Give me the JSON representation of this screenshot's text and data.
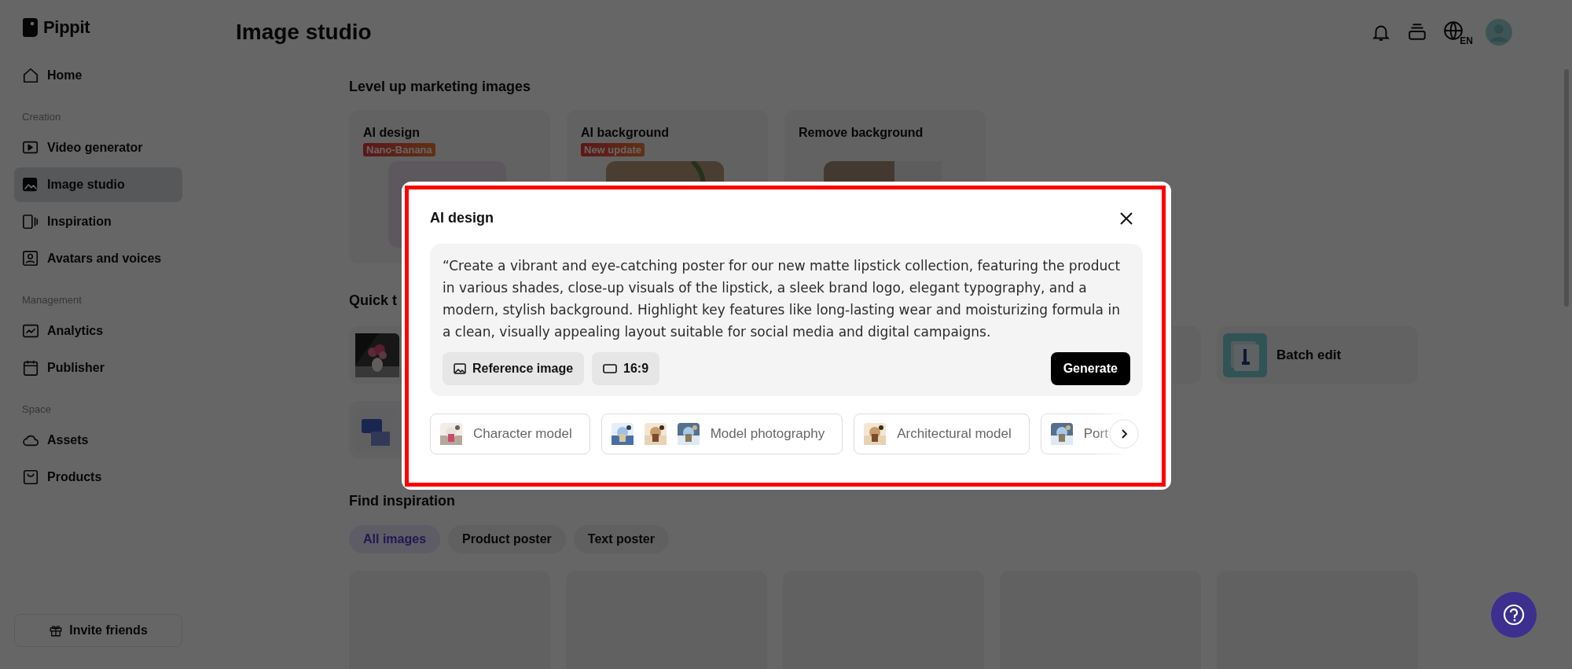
{
  "sidebar": {
    "logo": "Pippit",
    "items": [
      {
        "kind": "item",
        "label": "Home",
        "selected": false
      },
      {
        "kind": "section",
        "label": "Creation"
      },
      {
        "kind": "item",
        "label": "Video generator",
        "selected": false
      },
      {
        "kind": "item",
        "label": "Image studio",
        "selected": true
      },
      {
        "kind": "item",
        "label": "Inspiration",
        "selected": false
      },
      {
        "kind": "item",
        "label": "Avatars and voices",
        "selected": false
      },
      {
        "kind": "section",
        "label": "Management"
      },
      {
        "kind": "item",
        "label": "Analytics",
        "selected": false
      },
      {
        "kind": "item",
        "label": "Publisher",
        "selected": false
      },
      {
        "kind": "section",
        "label": "Space"
      },
      {
        "kind": "item",
        "label": "Assets",
        "selected": false
      },
      {
        "kind": "item",
        "label": "Products",
        "selected": false
      }
    ],
    "invite_button": "Invite friends"
  },
  "header": {
    "title": "Image studio",
    "language": "EN"
  },
  "marketing": {
    "heading": "Level up marketing images",
    "cards": [
      {
        "title": "AI design",
        "badge": "Nano-Banana"
      },
      {
        "title": "AI background",
        "badge": "New update"
      },
      {
        "title": "Remove background"
      }
    ]
  },
  "quick_tools": {
    "heading": "Quick t",
    "rows": [
      [
        {
          "kind": "picture"
        },
        {
          "kind": "blank"
        },
        {
          "kind": "labeled",
          "label": "Batch edit"
        }
      ],
      [
        {
          "kind": "picture"
        }
      ]
    ]
  },
  "modal": {
    "title": "AI design",
    "prompt": "“Create a vibrant and eye-catching poster for our new matte lipstick collection, featuring the product in various shades, close-up visuals of the lipstick, a sleek brand logo, elegant typography, and a modern, stylish background. Highlight key features like long-lasting wear and moisturizing formula in a clean, visually appealing layout suitable for social media and digital campaigns.",
    "reference_button": "Reference image",
    "ratio_button": "16:9",
    "generate_button": "Generate",
    "styles": [
      {
        "label": "Character model",
        "thumbnails": [
          {
            "kind": "picture"
          }
        ]
      },
      {
        "label": "Model photography",
        "thumbnails": [
          {
            "kind": "picture"
          },
          {
            "kind": "picture"
          },
          {
            "kind": "picture"
          }
        ]
      },
      {
        "label": "Architectural model",
        "thumbnails": [
          {
            "kind": "picture"
          }
        ]
      },
      {
        "label": "Port",
        "thumbnails": [
          {
            "kind": "picture"
          }
        ]
      }
    ]
  },
  "inspiration": {
    "heading": "Find inspiration",
    "filters": [
      {
        "label": "All images",
        "selected": true
      },
      {
        "label": "Product poster",
        "selected": false
      },
      {
        "label": "Text poster",
        "selected": false
      }
    ]
  }
}
